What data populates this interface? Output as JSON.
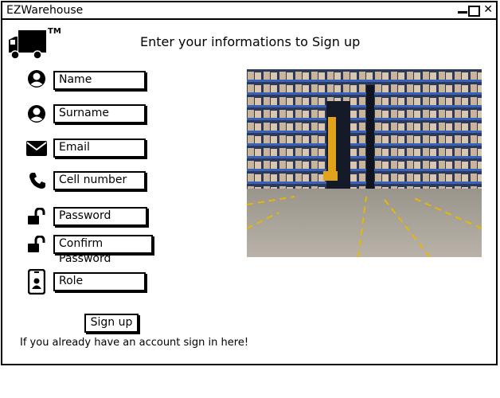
{
  "window": {
    "title": "EZWarehouse"
  },
  "logo": {
    "trademark": "TM"
  },
  "heading": "Enter your informations to Sign up",
  "fields": {
    "name": "Name",
    "surname": "Surname",
    "email": "Email",
    "cell": "Cell number",
    "password": "Password",
    "confirm_password": "Confirm Password",
    "role": "Role"
  },
  "signup_button": "Sign up",
  "signin_link": "If you already have an account sign in here!",
  "icons": {
    "logo": "truck-icon",
    "name": "user-icon",
    "surname": "user-icon",
    "email": "envelope-icon",
    "cell": "phone-icon",
    "password": "unlock-icon",
    "confirm_password": "unlock-icon",
    "role": "id-badge-icon"
  },
  "image": {
    "subject": "warehouse-shelves-photo"
  }
}
